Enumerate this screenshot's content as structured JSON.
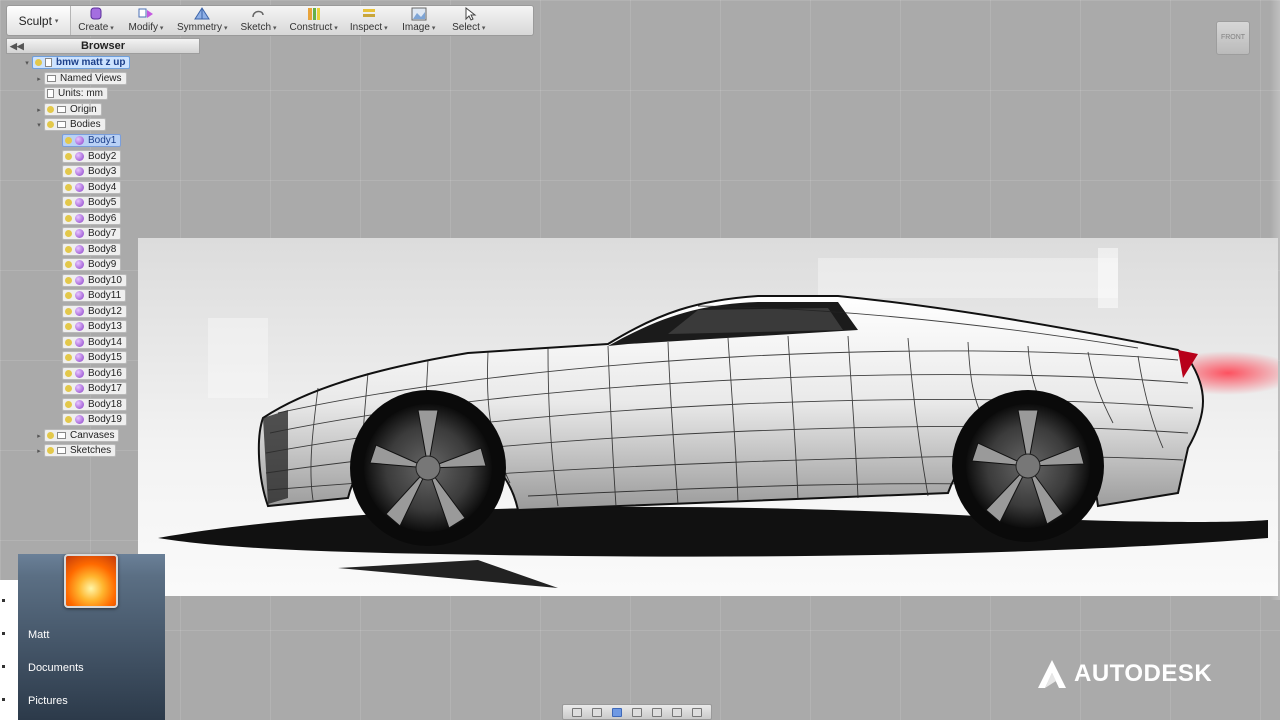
{
  "toolbar": {
    "workspace": "Sculpt",
    "buttons": [
      {
        "label": "Create",
        "icon": "create-icon"
      },
      {
        "label": "Modify",
        "icon": "modify-icon"
      },
      {
        "label": "Symmetry",
        "icon": "symmetry-icon"
      },
      {
        "label": "Sketch",
        "icon": "sketch-icon"
      },
      {
        "label": "Construct",
        "icon": "construct-icon"
      },
      {
        "label": "Inspect",
        "icon": "inspect-icon"
      },
      {
        "label": "Image",
        "icon": "image-icon"
      },
      {
        "label": "Select",
        "icon": "select-icon"
      }
    ]
  },
  "browser": {
    "title": "Browser",
    "root": "bmw matt z up",
    "named_views": "Named Views",
    "units": "Units: mm",
    "origin": "Origin",
    "bodies": "Bodies",
    "body_items": [
      "Body1",
      "Body2",
      "Body3",
      "Body4",
      "Body5",
      "Body6",
      "Body7",
      "Body8",
      "Body9",
      "Body10",
      "Body11",
      "Body12",
      "Body13",
      "Body14",
      "Body15",
      "Body16",
      "Body17",
      "Body18",
      "Body19"
    ],
    "canvases": "Canvases",
    "sketches": "Sketches"
  },
  "start_menu": {
    "items": [
      "Matt",
      "Documents",
      "Pictures"
    ]
  },
  "branding": {
    "autodesk": "AUTODESK"
  },
  "colors": {
    "accent": "#1c3f8a",
    "viewport": "#aaaaaa",
    "brake_light": "#e0202a"
  }
}
